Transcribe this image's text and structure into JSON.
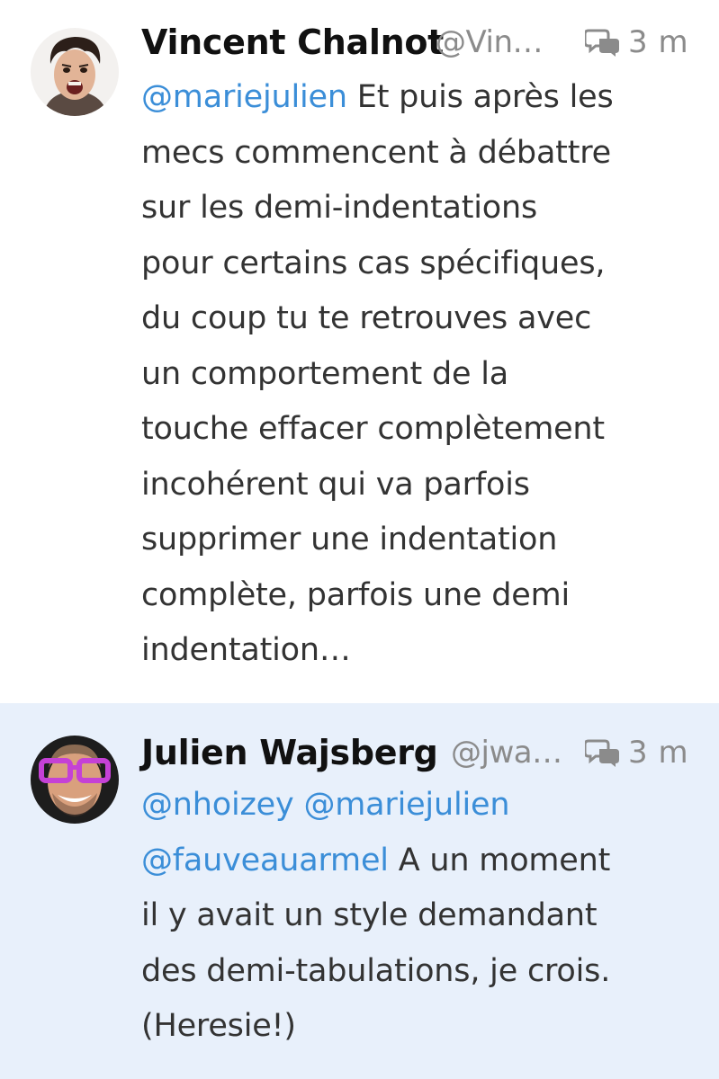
{
  "tweets": [
    {
      "display_name": "Vincent Chalnot",
      "handle": "@Vin…",
      "timestamp": "3 m",
      "reply_icon": "conversation-bubbles-icon",
      "mention_line": "@mariejulien",
      "first_line_rest": " Et puis après les",
      "lines": [
        "mecs commencent à débattre",
        "sur les demi-indentations",
        "pour certains cas spécifiques,",
        "du coup tu te retrouves avec",
        "un comportement de la",
        "touche effacer complètement",
        "incohérent qui va parfois",
        "supprimer une indentation",
        "complète, parfois une demi",
        "indentation…"
      ]
    },
    {
      "display_name": "Julien Wajsberg",
      "handle": "@jwa…",
      "timestamp": "3 m",
      "reply_icon": "conversation-bubbles-icon",
      "mentions_line": "@nhoizey @mariejulien",
      "mention_3": "@fauveauarmel",
      "third_line_rest": " A un moment",
      "lines": [
        "il y avait un style demandant",
        "des demi-tabulations, je crois.",
        "(Heresie!)"
      ]
    }
  ],
  "colors": {
    "mention": "#3b8ed8",
    "highlight_background": "#e8f0fb",
    "meta_gray": "#8b8b8b"
  }
}
